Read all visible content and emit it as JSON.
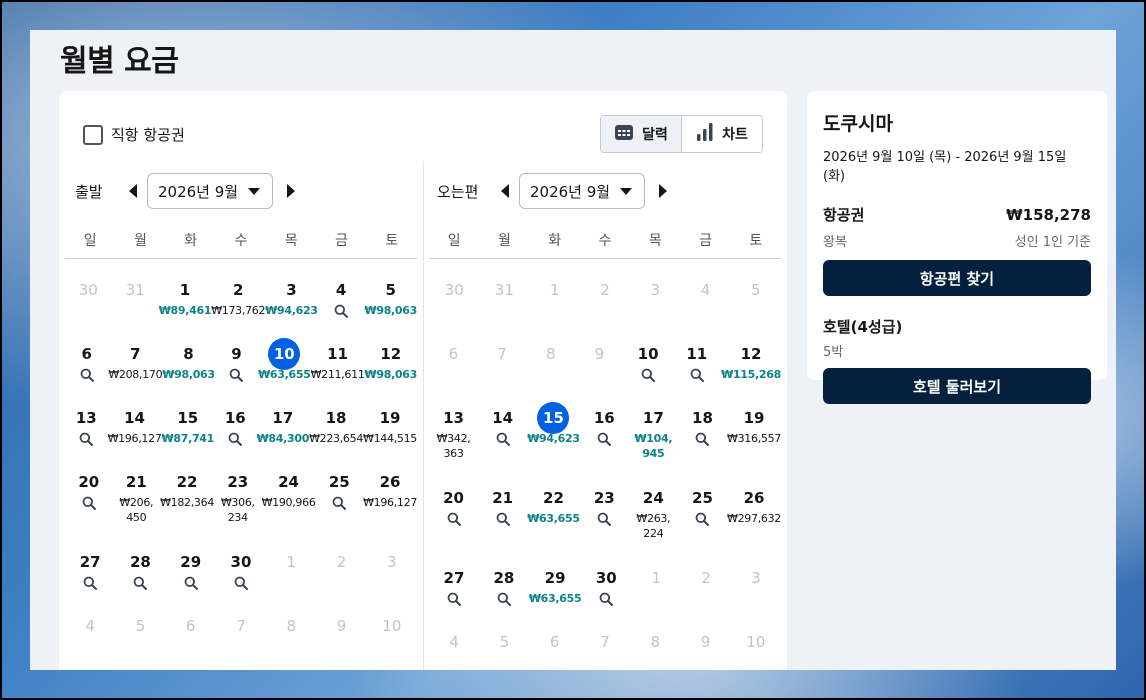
{
  "page": {
    "title": "월별 요금"
  },
  "filters": {
    "direct_label": "직항 항공권"
  },
  "view_toggle": {
    "calendar": "달력",
    "chart": "차트"
  },
  "outbound": {
    "label": "출발",
    "month": "2026년 9월",
    "weekdays": [
      "일",
      "월",
      "화",
      "수",
      "목",
      "금",
      "토"
    ],
    "weeks": [
      [
        {
          "d": "30",
          "dim": true
        },
        {
          "d": "31",
          "dim": true
        },
        {
          "d": "1",
          "p": "₩89,461",
          "c": true
        },
        {
          "d": "2",
          "p": "₩173,762"
        },
        {
          "d": "3",
          "p": "₩94,623",
          "c": true
        },
        {
          "d": "4",
          "m": true
        },
        {
          "d": "5",
          "p": "₩98,063",
          "c": true
        }
      ],
      [
        {
          "d": "6",
          "m": true
        },
        {
          "d": "7",
          "p": "₩208,170"
        },
        {
          "d": "8",
          "p": "₩98,063",
          "c": true
        },
        {
          "d": "9",
          "m": true
        },
        {
          "d": "10",
          "p": "₩63,655",
          "c": true,
          "sel": true
        },
        {
          "d": "11",
          "p": "₩211,611"
        },
        {
          "d": "12",
          "p": "₩98,063",
          "c": true
        }
      ],
      [
        {
          "d": "13",
          "m": true
        },
        {
          "d": "14",
          "p": "₩196,127"
        },
        {
          "d": "15",
          "p": "₩87,741",
          "c": true
        },
        {
          "d": "16",
          "m": true
        },
        {
          "d": "17",
          "p": "₩84,300",
          "c": true
        },
        {
          "d": "18",
          "p": "₩223,654"
        },
        {
          "d": "19",
          "p": "₩144,515"
        }
      ],
      [
        {
          "d": "20",
          "m": true
        },
        {
          "d": "21",
          "p": "₩206,\n450"
        },
        {
          "d": "22",
          "p": "₩182,364"
        },
        {
          "d": "23",
          "p": "₩306,\n234"
        },
        {
          "d": "24",
          "p": "₩190,966"
        },
        {
          "d": "25",
          "m": true
        },
        {
          "d": "26",
          "p": "₩196,127"
        }
      ],
      [
        {
          "d": "27",
          "m": true
        },
        {
          "d": "28",
          "m": true
        },
        {
          "d": "29",
          "m": true
        },
        {
          "d": "30",
          "m": true
        },
        {
          "d": "1",
          "dim": true
        },
        {
          "d": "2",
          "dim": true
        },
        {
          "d": "3",
          "dim": true
        }
      ],
      [
        {
          "d": "4",
          "dim": true
        },
        {
          "d": "5",
          "dim": true
        },
        {
          "d": "6",
          "dim": true
        },
        {
          "d": "7",
          "dim": true
        },
        {
          "d": "8",
          "dim": true
        },
        {
          "d": "9",
          "dim": true
        },
        {
          "d": "10",
          "dim": true
        }
      ]
    ]
  },
  "inbound": {
    "label": "오는편",
    "month": "2026년 9월",
    "weekdays": [
      "일",
      "월",
      "화",
      "수",
      "목",
      "금",
      "토"
    ],
    "weeks": [
      [
        {
          "d": "30",
          "dim": true
        },
        {
          "d": "31",
          "dim": true
        },
        {
          "d": "1",
          "dim": true
        },
        {
          "d": "2",
          "dim": true
        },
        {
          "d": "3",
          "dim": true
        },
        {
          "d": "4",
          "dim": true
        },
        {
          "d": "5",
          "dim": true
        }
      ],
      [
        {
          "d": "6",
          "dim": true
        },
        {
          "d": "7",
          "dim": true
        },
        {
          "d": "8",
          "dim": true
        },
        {
          "d": "9",
          "dim": true
        },
        {
          "d": "10",
          "m": true
        },
        {
          "d": "11",
          "m": true
        },
        {
          "d": "12",
          "p": "₩115,268",
          "c": true
        }
      ],
      [
        {
          "d": "13",
          "p": "₩342,\n363"
        },
        {
          "d": "14",
          "m": true
        },
        {
          "d": "15",
          "p": "₩94,623",
          "c": true,
          "sel": true
        },
        {
          "d": "16",
          "m": true
        },
        {
          "d": "17",
          "p": "₩104,\n945",
          "c": true
        },
        {
          "d": "18",
          "m": true
        },
        {
          "d": "19",
          "p": "₩316,557"
        }
      ],
      [
        {
          "d": "20",
          "m": true
        },
        {
          "d": "21",
          "m": true
        },
        {
          "d": "22",
          "p": "₩63,655",
          "c": true
        },
        {
          "d": "23",
          "m": true
        },
        {
          "d": "24",
          "p": "₩263,\n224"
        },
        {
          "d": "25",
          "m": true
        },
        {
          "d": "26",
          "p": "₩297,632"
        }
      ],
      [
        {
          "d": "27",
          "m": true
        },
        {
          "d": "28",
          "m": true
        },
        {
          "d": "29",
          "p": "₩63,655",
          "c": true
        },
        {
          "d": "30",
          "m": true
        },
        {
          "d": "1",
          "dim": true
        },
        {
          "d": "2",
          "dim": true
        },
        {
          "d": "3",
          "dim": true
        }
      ],
      [
        {
          "d": "4",
          "dim": true
        },
        {
          "d": "5",
          "dim": true
        },
        {
          "d": "6",
          "dim": true
        },
        {
          "d": "7",
          "dim": true
        },
        {
          "d": "8",
          "dim": true
        },
        {
          "d": "9",
          "dim": true
        },
        {
          "d": "10",
          "dim": true
        }
      ]
    ]
  },
  "summary": {
    "city": "도쿠시마",
    "dates": "2026년 9월 10일 (목) - 2026년 9월 15일 (화)",
    "flight": {
      "title": "항공권",
      "price": "₩158,278",
      "sub_left": "왕복",
      "sub_right": "성인 1인 기준",
      "button": "항공편 찾기"
    },
    "hotel": {
      "title": "호텔(4성급)",
      "sub": "5박",
      "button": "호텔 둘러보기"
    }
  },
  "colors": {
    "cheap": "#0c838a",
    "selected": "#0062e3",
    "button": "#05203c"
  },
  "icons": [
    "calendar-icon",
    "bar-chart-icon",
    "search-icon",
    "arrow-left-icon",
    "arrow-right-icon",
    "chevron-down-icon"
  ]
}
